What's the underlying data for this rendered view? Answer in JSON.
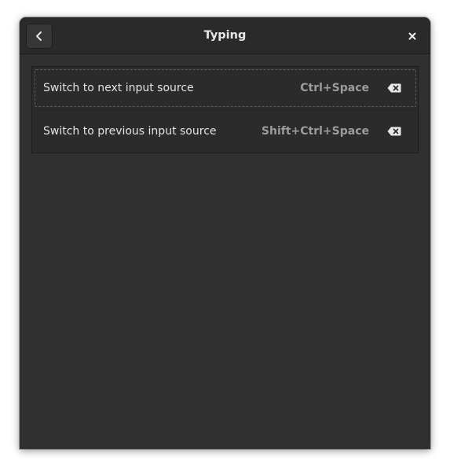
{
  "window": {
    "title": "Typing"
  },
  "header": {
    "back_icon": "go-previous-icon",
    "close_icon": "window-close-icon"
  },
  "shortcuts": [
    {
      "label": "Switch to next input source",
      "accelerator": "Ctrl+Space",
      "clear_icon": "edit-clear-backspace-icon",
      "focused": true
    },
    {
      "label": "Switch to previous input source",
      "accelerator": "Shift+Ctrl+Space",
      "clear_icon": "edit-clear-backspace-icon",
      "focused": false
    }
  ],
  "colors": {
    "window_bg": "#303030",
    "headerbar_bg": "#2a2a2a",
    "list_bg": "#2b2b2b",
    "text": "#e3e3e3",
    "accel_text": "#9c9c9c"
  }
}
